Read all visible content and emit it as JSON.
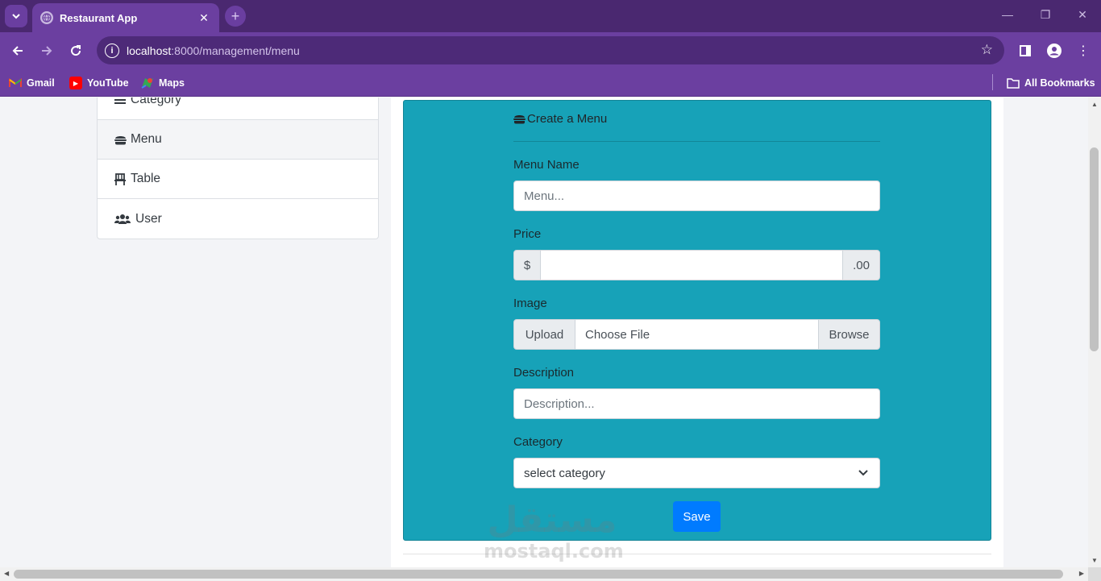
{
  "browser": {
    "tab_title": "Restaurant App",
    "url_host": "localhost",
    "url_path": ":8000/management/menu",
    "bookmarks": [
      {
        "label": "Gmail"
      },
      {
        "label": "YouTube"
      },
      {
        "label": "Maps"
      }
    ],
    "all_bookmarks": "All Bookmarks"
  },
  "sidebar": {
    "items": [
      {
        "label": "Category",
        "icon": "bars-icon"
      },
      {
        "label": "Menu",
        "icon": "hamburger-icon"
      },
      {
        "label": "Table",
        "icon": "chair-icon"
      },
      {
        "label": "User",
        "icon": "users-icon"
      }
    ]
  },
  "form": {
    "title": "Create a Menu",
    "menu_name_label": "Menu Name",
    "menu_name_placeholder": "Menu...",
    "price_label": "Price",
    "price_prefix": "$",
    "price_suffix": ".00",
    "image_label": "Image",
    "upload_label": "Upload",
    "choose_file": "Choose File",
    "browse_label": "Browse",
    "description_label": "Description",
    "description_placeholder": "Description...",
    "category_label": "Category",
    "category_selected": "select category",
    "save_label": "Save"
  },
  "watermark": {
    "arabic": "مستقل",
    "latin": "mostaql.com"
  },
  "colors": {
    "panel": "#17a2b8",
    "primary": "#007bff",
    "browser": "#6b3fa0"
  }
}
